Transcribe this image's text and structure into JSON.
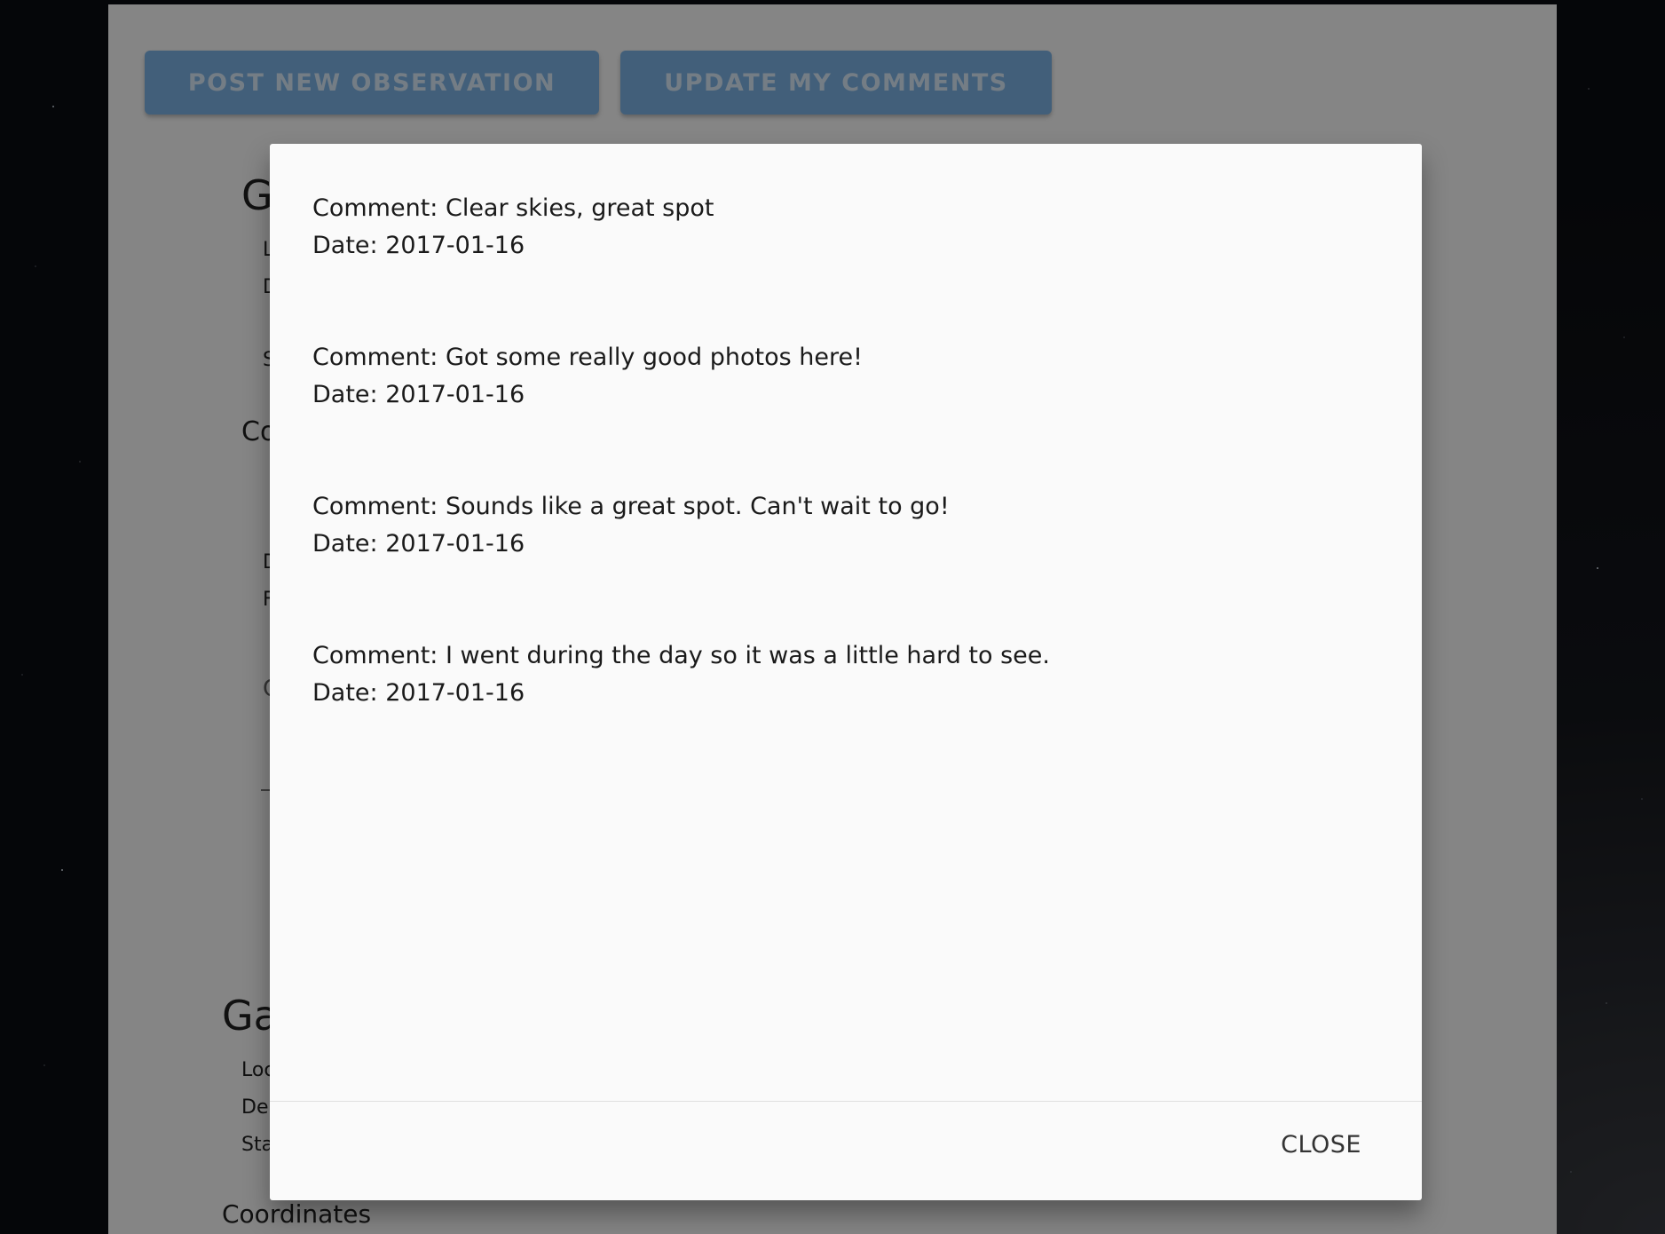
{
  "toolbar": {
    "post_label": "POST NEW OBSERVATION",
    "update_label": "UPDATE MY COMMENTS"
  },
  "background_page": {
    "first_card_heading": "G",
    "first_card_lines": [
      "L",
      "D",
      "S"
    ],
    "first_card_section": "Co",
    "first_card_lines2": [
      "D",
      "F",
      "C"
    ],
    "second_card_heading": "Ga",
    "second_card_lines": [
      "Loc",
      "De",
      "Sta"
    ],
    "second_card_section": "Coordinates"
  },
  "modal": {
    "comments": [
      {
        "comment": "Comment: Clear skies, great spot",
        "date": "Date: 2017-01-16"
      },
      {
        "comment": "Comment: Got some really good photos here!",
        "date": "Date: 2017-01-16"
      },
      {
        "comment": "Comment: Sounds like a great spot. Can't wait to go!",
        "date": "Date: 2017-01-16"
      },
      {
        "comment": "Comment: I went during the day so it was a little hard to see.",
        "date": "Date: 2017-01-16"
      }
    ],
    "close_label": "CLOSE"
  }
}
